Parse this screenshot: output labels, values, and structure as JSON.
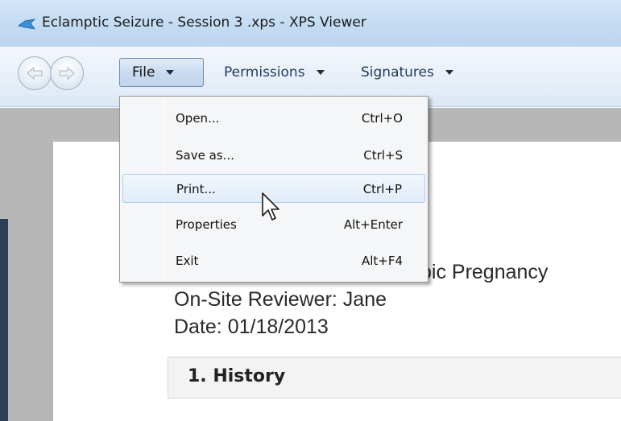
{
  "window": {
    "title": "Eclamptic Seizure - Session 3 .xps - XPS Viewer",
    "icon": "xps-viewer-icon"
  },
  "toolbar": {
    "back_icon": "back-arrow-icon",
    "forward_icon": "forward-arrow-icon",
    "menus": [
      {
        "label": "File"
      },
      {
        "label": "Permissions"
      },
      {
        "label": "Signatures"
      }
    ]
  },
  "file_menu": {
    "items": [
      {
        "label": "Open...",
        "shortcut": "Ctrl+O"
      },
      {
        "label": "Save as...",
        "shortcut": "Ctrl+S"
      },
      {
        "label": "Print...",
        "shortcut": "Ctrl+P",
        "highlighted": true
      },
      {
        "label": "Properties",
        "shortcut": "Alt+Enter"
      },
      {
        "label": "Exit",
        "shortcut": "Alt+F4"
      }
    ]
  },
  "document": {
    "line1_partial": "pic Pregnancy",
    "line2": "On-Site Reviewer: Jane",
    "line3": "Date: 01/18/2013",
    "section_title": "1. History"
  },
  "colors": {
    "titlebar": "#c3dbf2",
    "menu_highlight": "#e1ecf9",
    "doc_background": "#b7b7b7"
  }
}
